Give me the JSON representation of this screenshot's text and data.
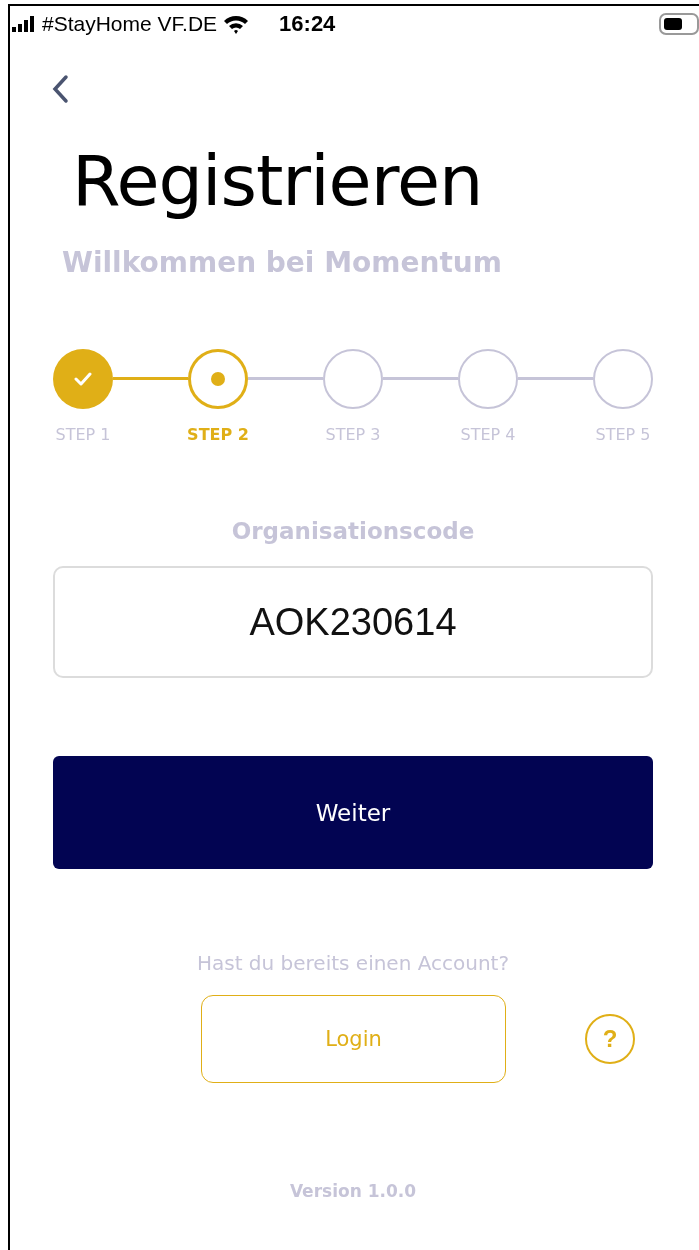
{
  "status_bar": {
    "carrier": "#StayHome VF.DE",
    "time": "16:24"
  },
  "title": "Registrieren",
  "subtitle": "Willkommen bei Momentum",
  "steps": [
    {
      "label": "STEP 1",
      "kind": "done"
    },
    {
      "label": "STEP 2",
      "kind": "current"
    },
    {
      "label": "STEP 3",
      "kind": "todo"
    },
    {
      "label": "STEP 4",
      "kind": "todo"
    },
    {
      "label": "STEP 5",
      "kind": "todo"
    }
  ],
  "field": {
    "label": "Organisationscode",
    "value": "AOK230614"
  },
  "primary_button": "Weiter",
  "account_prompt": "Hast du bereits einen Account?",
  "login_button": "Login",
  "help_button": "?",
  "version": "Version 1.0.0"
}
